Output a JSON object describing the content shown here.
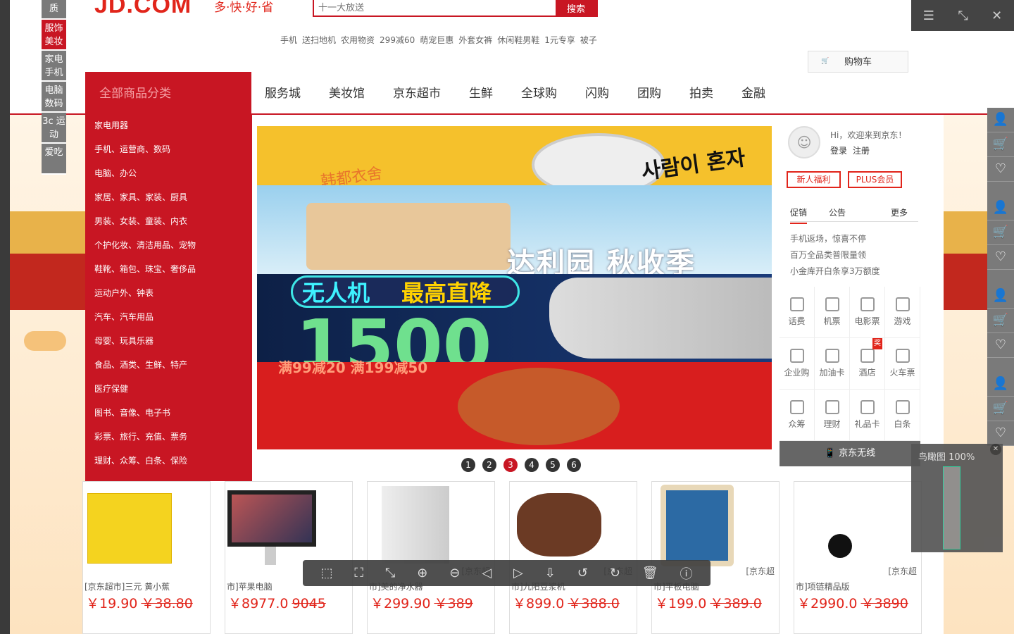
{
  "left_tabs": [
    "质",
    "服饰美妆",
    "家电手机",
    "电脑数码",
    "3c 运动",
    "爱吃"
  ],
  "logo": {
    "text": "JD.COM",
    "slogan": "多·快·好·省"
  },
  "search": {
    "placeholder": "十一大放送",
    "button": "搜索"
  },
  "hotwords": [
    "手机",
    "送扫地机",
    "农用物资",
    "299减60",
    "萌宠巨惠",
    "外套女裤",
    "休闲鞋男鞋",
    "1元专享",
    "被子"
  ],
  "cart": {
    "label": "购物车"
  },
  "nav": {
    "all_categories": "全部商品分类",
    "links": [
      "服务城",
      "美妆馆",
      "京东超市",
      "生鲜",
      "全球购",
      "闪购",
      "团购",
      "拍卖",
      "金融"
    ]
  },
  "categories": [
    "家电用器",
    "手机、运营商、数码",
    "电脑、办公",
    "家居、家具、家装、厨具",
    "男装、女装、童装、内衣",
    "个护化妆、清洁用品、宠物",
    "鞋靴、箱包、珠宝、奢侈品",
    "运动户外、钟表",
    "汽车、汽车用品",
    "母婴、玩具乐器",
    "食品、酒类、生鲜、特产",
    "医疗保健",
    "图书、音像、电子书",
    "彩票、旅行、充值、票务",
    "理财、众筹、白条、保险"
  ],
  "banner": {
    "b1_korean": "사람이 혼자",
    "b1_text": "韩都衣舍",
    "b2_text": "达利园 秋收季",
    "b3_left": "无人机",
    "b3_right": "最高直降",
    "b3_big": "1500",
    "b4_text": "满99减20 满199减50",
    "dots": [
      "1",
      "2",
      "3",
      "4",
      "5",
      "6"
    ],
    "active_dot": 3
  },
  "user_panel": {
    "greeting": "Hi，欢迎来到京东！",
    "login": "登录",
    "register": "注册",
    "btn_new": "新人福利",
    "btn_plus": "PLUS会员",
    "tabs": [
      "促销",
      "公告",
      "更多"
    ],
    "promos": [
      "手机返场，惊喜不停",
      "百万全品类普限量领",
      "小金库开白条享3万额度"
    ],
    "services": [
      "话费",
      "机票",
      "电影票",
      "游戏",
      "企业购",
      "加油卡",
      "酒店",
      "火车票",
      "众筹",
      "理财",
      "礼品卡",
      "白条"
    ],
    "hotel_badge": "奖",
    "wireless": "京东无线"
  },
  "products": [
    {
      "name": "[京东超市]三元 黄小蕉",
      "price": "￥19.90",
      "old": "￥38.80",
      "src": ""
    },
    {
      "name": "市]苹果电脑",
      "price": "￥8977.0",
      "old": "9045",
      "src": ""
    },
    {
      "name": "市]美的净水器",
      "price": "￥299.90",
      "old": "￥389",
      "src": "[京东超"
    },
    {
      "name": "市]九阳豆浆机",
      "price": "￥899.0",
      "old": "￥388.0",
      "src": "[京东超"
    },
    {
      "name": "市]平板电脑",
      "price": "￥199.0",
      "old": "￥389.0",
      "src": "[京东超"
    },
    {
      "name": "市]项链精品版",
      "price": "￥2990.0",
      "old": "￥3890",
      "src": "[京东超"
    }
  ],
  "birdseye": {
    "label": "鸟瞰图 100%"
  },
  "colors": {
    "brand_red": "#c81623",
    "price_red": "#e1251b"
  }
}
